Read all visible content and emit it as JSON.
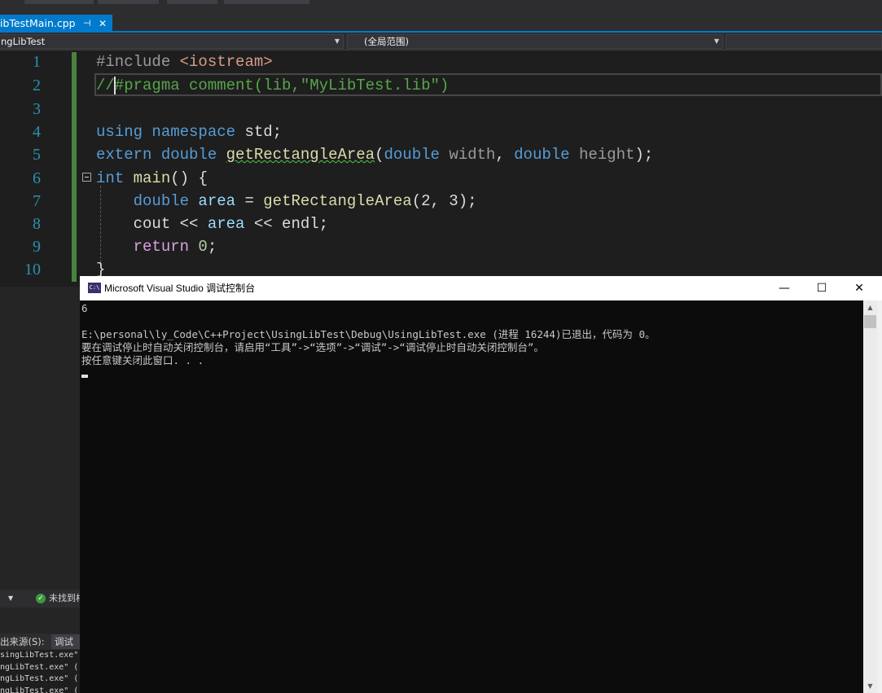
{
  "editor_tab": {
    "label": "ibTestMain.cpp",
    "pin": "⊣",
    "close": "✕"
  },
  "navbar": {
    "project": "ngLibTest",
    "scope": "(全局范围)"
  },
  "code_lines": {
    "numbers": [
      "1",
      "2",
      "3",
      "4",
      "5",
      "6",
      "7",
      "8",
      "9",
      "10"
    ],
    "l1_pp": "#include ",
    "l1_inc": "<iostream>",
    "l2": "//#pragma comment(lib,\"MyLibTest.lib\")",
    "l4_kw1": "using",
    "l4_kw2": " namespace",
    "l4_rest": " std;",
    "l5_kw1": "extern",
    "l5_kw2": " double",
    "l5_fn": "getRectangleArea",
    "l5_p1": "(",
    "l5_kw3": "double",
    "l5_a1": " width",
    "l5_c": ", ",
    "l5_kw4": "double",
    "l5_a2": " height",
    "l5_end": ");",
    "l6_kw": "int",
    "l6_fn": " main",
    "l6_rest": "() {",
    "l7_kw": "double",
    "l7_var": " area",
    "l7_eq": " = ",
    "l7_fn": "getRectangleArea",
    "l7_args": "(2, 3);",
    "l8_id": "cout",
    "l8_op": " << ",
    "l8_var": "area",
    "l8_op2": " << ",
    "l8_end": "endl;",
    "l9_kw": "return",
    "l9_num": " 0",
    "l9_end": ";",
    "l10": "}"
  },
  "status": {
    "not_found": "未找到相"
  },
  "output_panel": {
    "source_label": "出来源(S):",
    "source_value": "调试",
    "lines": [
      "singLibTest.exe\" (",
      "ngLibTest.exe\" (",
      "ngLibTest.exe\" (",
      "ngLibTest.exe\" ("
    ]
  },
  "console": {
    "title": "Microsoft Visual Studio 调试控制台",
    "icon": "C:\\",
    "min": "—",
    "max": "☐",
    "close": "✕",
    "output": "6\n\nE:\\personal\\ly_Code\\C++Project\\UsingLibTest\\Debug\\UsingLibTest.exe (进程 16244)已退出，代码为 0。\n要在调试停止时自动关闭控制台，请启用“工具”->“选项”->“调试”->“调试停止时自动关闭控制台”。\n按任意键关闭此窗口. . ."
  },
  "colors": {
    "accent": "#007acc",
    "keyword": "#569cd6",
    "comment": "#57a64a",
    "function": "#dcdcaa",
    "variable": "#9cdcfe",
    "line_number": "#2b91af"
  }
}
